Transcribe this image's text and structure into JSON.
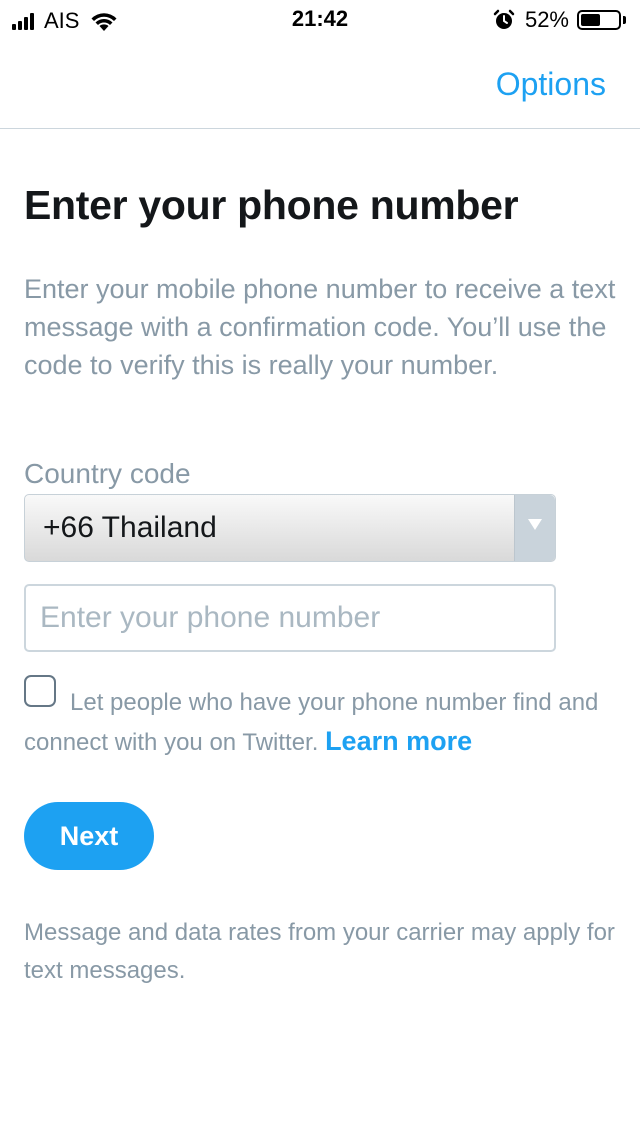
{
  "status_bar": {
    "carrier": "AIS",
    "time": "21:42",
    "battery_percent": "52%",
    "battery_level": 0.52
  },
  "nav": {
    "options_label": "Options"
  },
  "page": {
    "title": "Enter your phone number",
    "description": "Enter your mobile phone number to receive a text message with a confirmation code. You’ll use the code to verify this is really your number."
  },
  "form": {
    "country_code_label": "Country code",
    "country_selected": "+66 Thailand",
    "phone_placeholder": "Enter your phone number",
    "phone_value": "",
    "discoverability_text": "Let people who have your phone number find and connect with you on Twitter.",
    "discoverability_checked": false,
    "learn_more_label": "Learn more",
    "next_label": "Next"
  },
  "footnote": "Message and data rates from your carrier may apply for text messages.",
  "colors": {
    "accent": "#1da1f2",
    "secondary_text": "#8899a6",
    "primary_text": "#14171a"
  },
  "icons": [
    "cellular-signal-icon",
    "wifi-icon",
    "alarm-icon",
    "battery-icon",
    "dropdown-arrow-icon"
  ]
}
